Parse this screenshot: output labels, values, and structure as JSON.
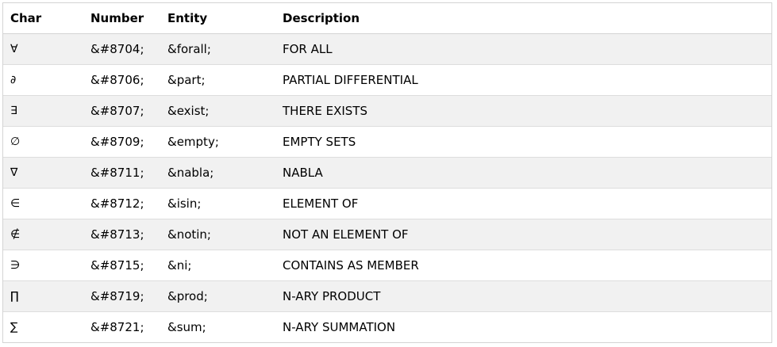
{
  "table": {
    "headers": [
      "Char",
      "Number",
      "Entity",
      "Description"
    ],
    "rows": [
      {
        "char": "∀",
        "number": "&#8704;",
        "entity": "&forall;",
        "description": "FOR ALL"
      },
      {
        "char": "∂",
        "number": "&#8706;",
        "entity": "&part;",
        "description": "PARTIAL DIFFERENTIAL"
      },
      {
        "char": "∃",
        "number": "&#8707;",
        "entity": "&exist;",
        "description": "THERE EXISTS"
      },
      {
        "char": "∅",
        "number": "&#8709;",
        "entity": "&empty;",
        "description": "EMPTY SETS"
      },
      {
        "char": "∇",
        "number": "&#8711;",
        "entity": "&nabla;",
        "description": "NABLA"
      },
      {
        "char": "∈",
        "number": "&#8712;",
        "entity": "&isin;",
        "description": "ELEMENT OF"
      },
      {
        "char": "∉",
        "number": "&#8713;",
        "entity": "&notin;",
        "description": "NOT AN ELEMENT OF"
      },
      {
        "char": "∋",
        "number": "&#8715;",
        "entity": "&ni;",
        "description": "CONTAINS AS MEMBER"
      },
      {
        "char": "∏",
        "number": "&#8719;",
        "entity": "&prod;",
        "description": "N-ARY PRODUCT"
      },
      {
        "char": "∑",
        "number": "&#8721;",
        "entity": "&sum;",
        "description": "N-ARY SUMMATION"
      }
    ]
  }
}
